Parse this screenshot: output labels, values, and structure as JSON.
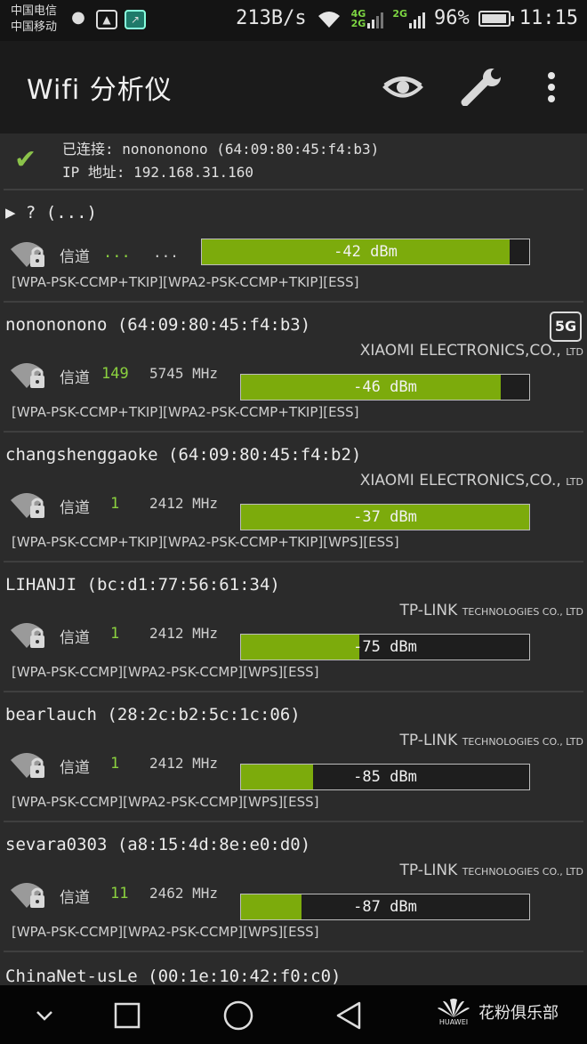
{
  "status_bar": {
    "carrier1": "中国电信",
    "carrier2": "中国移动",
    "net_speed": "213B/s",
    "net_4g": "4G",
    "net_2g_a": "2G",
    "net_2g_b": "2G",
    "battery": "96%",
    "battery_level": 0.96,
    "time": "11:15"
  },
  "app_bar": {
    "title": "Wifi 分析仪",
    "eye_icon": "eye-icon",
    "wrench_icon": "wrench-icon",
    "more_icon": "more-vertical-icon"
  },
  "connected": {
    "line1": "已连接: nonononono (64:09:80:45:f4:b3)",
    "line2": "IP 地址: 192.168.31.160"
  },
  "networks": [
    {
      "ssid": "▶ ? (...)",
      "channel_label": "信道",
      "channel": "...",
      "freq": "...",
      "vendor": "",
      "vendor_suffix": "",
      "badge": "",
      "signal": "-42 dBm",
      "signal_fraction": 0.94,
      "caps": "[WPA-PSK-CCMP+TKIP][WPA2-PSK-CCMP+TKIP][ESS]"
    },
    {
      "ssid": "nonononono (64:09:80:45:f4:b3)",
      "channel_label": "信道",
      "channel": "149",
      "freq": "5745 MHz",
      "vendor": "XIAOMI ELECTRONICS,CO.,",
      "vendor_suffix": "LTD",
      "badge": "5G",
      "signal": "-46 dBm",
      "signal_fraction": 0.9,
      "caps": "[WPA-PSK-CCMP+TKIP][WPA2-PSK-CCMP+TKIP][ESS]"
    },
    {
      "ssid": "changshenggaoke (64:09:80:45:f4:b2)",
      "channel_label": "信道",
      "channel": "1",
      "freq": "2412 MHz",
      "vendor": "XIAOMI ELECTRONICS,CO.,",
      "vendor_suffix": "LTD",
      "badge": "",
      "signal": "-37 dBm",
      "signal_fraction": 1.0,
      "caps": "[WPA-PSK-CCMP+TKIP][WPA2-PSK-CCMP+TKIP][WPS][ESS]"
    },
    {
      "ssid": "LIHANJI (bc:d1:77:56:61:34)",
      "channel_label": "信道",
      "channel": "1",
      "freq": "2412 MHz",
      "vendor": "TP-LINK",
      "vendor_suffix": "TECHNOLOGIES CO., LTD",
      "badge": "",
      "signal": "-75 dBm",
      "signal_fraction": 0.41,
      "caps": "[WPA-PSK-CCMP][WPA2-PSK-CCMP][WPS][ESS]"
    },
    {
      "ssid": "bearlauch (28:2c:b2:5c:1c:06)",
      "channel_label": "信道",
      "channel": "1",
      "freq": "2412 MHz",
      "vendor": "TP-LINK",
      "vendor_suffix": "TECHNOLOGIES CO., LTD",
      "badge": "",
      "signal": "-85 dBm",
      "signal_fraction": 0.25,
      "caps": "[WPA-PSK-CCMP][WPA2-PSK-CCMP][WPS][ESS]"
    },
    {
      "ssid": "sevara0303 (a8:15:4d:8e:e0:d0)",
      "channel_label": "信道",
      "channel": "11",
      "freq": "2462 MHz",
      "vendor": "TP-LINK",
      "vendor_suffix": "TECHNOLOGIES CO., LTD",
      "badge": "",
      "signal": "-87 dBm",
      "signal_fraction": 0.21,
      "caps": "[WPA-PSK-CCMP][WPA2-PSK-CCMP][WPS][ESS]"
    }
  ],
  "partial_network": {
    "ssid": "ChinaNet-usLe (00:1e:10:42:f0:c0)"
  },
  "nav_bar": {
    "brand_text": "花粉俱乐部",
    "brand_logo": "HUAWEI"
  }
}
